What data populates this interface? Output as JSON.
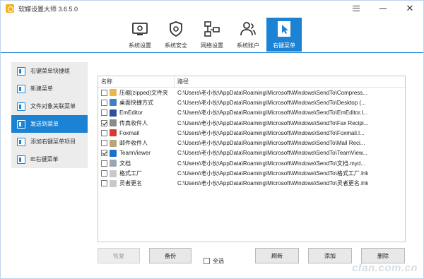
{
  "window": {
    "title": "软媒设置大师 3.6.5.0"
  },
  "topnav": [
    {
      "label": "系统设置",
      "icon": "settings-window-icon",
      "active": false
    },
    {
      "label": "系统安全",
      "icon": "shield-gear-icon",
      "active": false
    },
    {
      "label": "网络设置",
      "icon": "network-icon",
      "active": false
    },
    {
      "label": "系统账户",
      "icon": "users-icon",
      "active": false
    },
    {
      "label": "右键菜单",
      "icon": "cursor-icon",
      "active": true
    }
  ],
  "sidebar": [
    {
      "label": "右键菜单快捷组",
      "active": false
    },
    {
      "label": "新建菜单",
      "active": false
    },
    {
      "label": "文件对象关联菜单",
      "active": false
    },
    {
      "label": "发送到菜单",
      "active": true
    },
    {
      "label": "添加右键菜单项目",
      "active": false
    },
    {
      "label": "IE右键菜单",
      "active": false
    }
  ],
  "table": {
    "columns": {
      "name": "名称",
      "path": "路径"
    },
    "rows": [
      {
        "name": "压缩(zipped)文件夹",
        "path": "C:\\Users\\老小伙\\AppData\\Roaming\\Microsoft\\Windows\\SendTo\\Compress...",
        "checked": false,
        "icon": "zip-folder-icon",
        "color": "#e9b84a"
      },
      {
        "name": "桌面快捷方式",
        "path": "C:\\Users\\老小伙\\AppData\\Roaming\\Microsoft\\Windows\\SendTo\\Desktop (...",
        "checked": false,
        "icon": "desktop-icon",
        "color": "#3f7fc9"
      },
      {
        "name": "EmEditor",
        "path": "C:\\Users\\老小伙\\AppData\\Roaming\\Microsoft\\Windows\\SendTo\\EmEditor.l...",
        "checked": false,
        "icon": "emeditor-icon",
        "color": "#2d4f9c"
      },
      {
        "name": "传真收件人",
        "path": "C:\\Users\\老小伙\\AppData\\Roaming\\Microsoft\\Windows\\SendTo\\Fax Recipi...",
        "checked": true,
        "icon": "fax-icon",
        "color": "#8a8a8a"
      },
      {
        "name": "Foxmail",
        "path": "C:\\Users\\老小伙\\AppData\\Roaming\\Microsoft\\Windows\\SendTo\\Foxmail.l...",
        "checked": false,
        "icon": "foxmail-icon",
        "color": "#d83b2b"
      },
      {
        "name": "邮件收件人",
        "path": "C:\\Users\\老小伙\\AppData\\Roaming\\Microsoft\\Windows\\SendTo\\Mail Reci...",
        "checked": false,
        "icon": "mail-icon",
        "color": "#b9a57a"
      },
      {
        "name": "TeamViewer",
        "path": "C:\\Users\\老小伙\\AppData\\Roaming\\Microsoft\\Windows\\SendTo\\TeamView...",
        "checked": true,
        "icon": "teamviewer-icon",
        "color": "#1b6fd1"
      },
      {
        "name": "文档",
        "path": "C:\\Users\\老小伙\\AppData\\Roaming\\Microsoft\\Windows\\SendTo\\文档.myd...",
        "checked": false,
        "icon": "documents-icon",
        "color": "#9aa4b3"
      },
      {
        "name": "格式工厂",
        "path": "C:\\Users\\老小伙\\AppData\\Roaming\\Microsoft\\Windows\\SendTo\\格式工厂.lnk",
        "checked": false,
        "icon": "format-factory-icon",
        "color": "#c9c9c9"
      },
      {
        "name": "灵者更名",
        "path": "C:\\Users\\老小伙\\AppData\\Roaming\\Microsoft\\Windows\\SendTo\\灵者更名.lnk",
        "checked": false,
        "icon": "rename-tool-icon",
        "color": "#c9c9c9"
      }
    ]
  },
  "buttons": {
    "restore": "恢复",
    "backup": "备份",
    "select_all": "全选",
    "refresh": "刷新",
    "add": "添加",
    "delete": "删除"
  },
  "watermark": "cfan.com.cn",
  "colors": {
    "accent": "#1c82d4"
  }
}
